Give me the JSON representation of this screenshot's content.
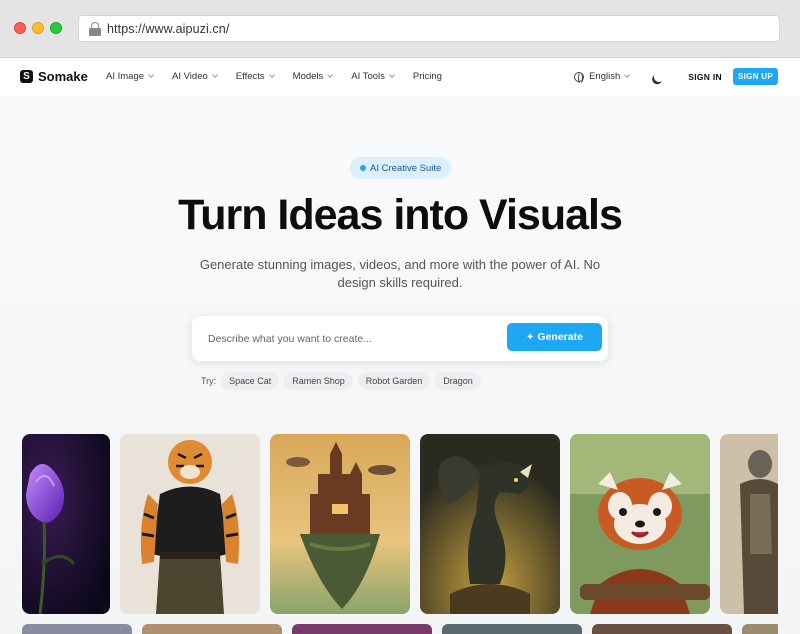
{
  "browser": {
    "url": "https://www.aipuzi.cn/"
  },
  "nav": {
    "brand": "Somake",
    "brand_logo_letter": "S",
    "items": [
      {
        "label": "AI Image",
        "dropdown": true
      },
      {
        "label": "AI Video",
        "dropdown": true
      },
      {
        "label": "Effects",
        "dropdown": true
      },
      {
        "label": "Models",
        "dropdown": true
      },
      {
        "label": "AI Tools",
        "dropdown": true
      },
      {
        "label": "Pricing",
        "dropdown": false
      }
    ],
    "language": "English",
    "sign_in": "SIGN IN",
    "sign_up": "SIGN UP"
  },
  "hero": {
    "badge": "AI Creative Suite",
    "headline": "Turn Ideas into Visuals",
    "subtitle": "Generate stunning images, videos, and more with the power of AI. No design skills required.",
    "search_placeholder": "Describe what you want to create...",
    "generate_label": "Generate",
    "try_label": "Try:",
    "suggestions": [
      "Space Cat",
      "Ramen Shop",
      "Robot Garden",
      "Dragon"
    ]
  },
  "gallery": [
    {
      "subject": "purple tulip"
    },
    {
      "subject": "tiger warrior"
    },
    {
      "subject": "floating castle"
    },
    {
      "subject": "dragon"
    },
    {
      "subject": "red panda"
    },
    {
      "subject": "armored soldier"
    }
  ],
  "colors": {
    "accent": "#1ea7f3",
    "badge_bg": "#dcefff",
    "text_dark": "#0d0d0d"
  }
}
